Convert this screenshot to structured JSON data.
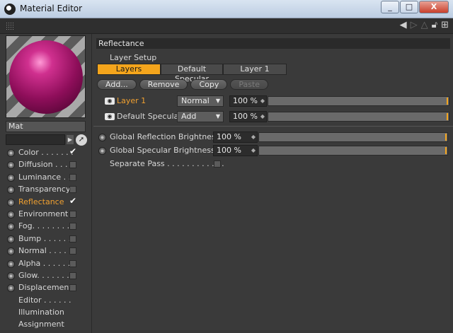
{
  "window": {
    "title": "Material Editor",
    "buttons": [
      "_",
      "□",
      "X"
    ]
  },
  "toolbar": {
    "icons": [
      "back-arrow-icon",
      "forward-arrow-icon",
      "up-arrow-icon",
      "lock-icon",
      "new-window-icon"
    ]
  },
  "material": {
    "name": "Mat",
    "colors": {
      "sphere": "#c0207f",
      "accent": "#f4a51c"
    }
  },
  "channels": [
    {
      "label": "Color . . . . . . .",
      "checked": true,
      "active": false
    },
    {
      "label": "Diffusion . . .",
      "checked": false,
      "active": false
    },
    {
      "label": "Luminance . .",
      "checked": false,
      "active": false
    },
    {
      "label": "Transparency",
      "checked": false,
      "active": false
    },
    {
      "label": "Reflectance",
      "checked": true,
      "active": true
    },
    {
      "label": "Environment",
      "checked": false,
      "active": false
    },
    {
      "label": "Fog. . . . . . . .",
      "checked": false,
      "active": false
    },
    {
      "label": "Bump . . . . . .",
      "checked": false,
      "active": false
    },
    {
      "label": "Normal . . . . .",
      "checked": false,
      "active": false
    },
    {
      "label": "Alpha . . . . . .",
      "checked": false,
      "active": false
    },
    {
      "label": "Glow. . . . . . .",
      "checked": false,
      "active": false
    },
    {
      "label": "Displacement",
      "checked": false,
      "active": false
    },
    {
      "label": "Editor . . . . . .",
      "plain": true
    },
    {
      "label": "Illumination",
      "plain": true
    },
    {
      "label": "Assignment",
      "plain": true
    }
  ],
  "reflectance": {
    "header": "Reflectance",
    "layer_setup": "Layer Setup",
    "tabs": [
      {
        "label": "Layers",
        "active": true
      },
      {
        "label": "Default Specular",
        "active": false
      },
      {
        "label": "Layer 1",
        "active": false
      }
    ],
    "buttons": {
      "add": "Add...",
      "remove": "Remove",
      "copy": "Copy",
      "paste": "Paste"
    },
    "layers": [
      {
        "name": "Layer 1",
        "mode": "Normal",
        "value": "100 %",
        "active": true
      },
      {
        "name": "Default Specular",
        "mode": "Add",
        "value": "100 %",
        "active": false
      }
    ],
    "global_reflection": {
      "label": "Global Reflection Brightness",
      "value": "100 %"
    },
    "global_specular": {
      "label": "Global Specular Brightness",
      "value": "100 %"
    },
    "separate_pass": {
      "label": "Separate Pass . . . . . . . . . . . .",
      "checked": false
    }
  }
}
